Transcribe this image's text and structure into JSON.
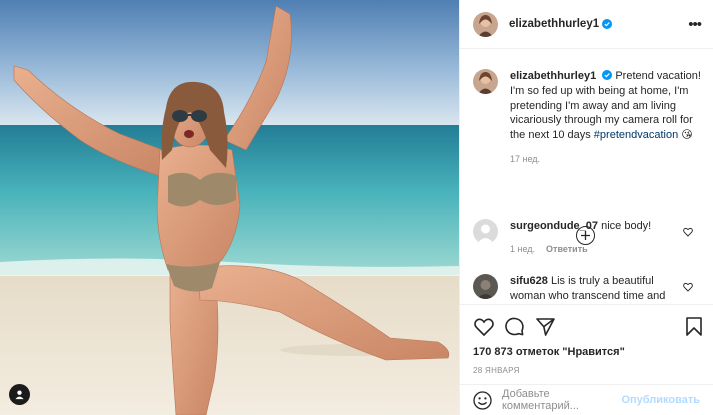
{
  "colors": {
    "accent": "#0095f6",
    "publish_disabled": "#b3dbff",
    "secondary_text": "#8e8e8e",
    "hashtag": "#00376b"
  },
  "header": {
    "username": "elizabethhurley1",
    "verified": true,
    "more_icon": "more-options-icon"
  },
  "caption": {
    "username": "elizabethhurley1",
    "text": "Pretend vacation! I'm so fed up with being at home, I'm pretending I'm away and am living vicariously through my camera roll for the next 10 days",
    "hashtag": "#pretendvacation",
    "emoji": "😘",
    "time": "17 нед."
  },
  "comments": [
    {
      "username": "surgeondude_07",
      "text": "nice body!",
      "time": "1 нед.",
      "reply_label": "Ответить"
    },
    {
      "username": "sifu628",
      "text": "Lis is truly a beautiful woman who transcend time and"
    }
  ],
  "actions": {
    "likes": "170 873 отметок \"Нравится\"",
    "date": "28 ЯНВАРЯ"
  },
  "add_comment": {
    "placeholder": "Добавьте комментарий...",
    "publish_label": "Опубликовать"
  }
}
